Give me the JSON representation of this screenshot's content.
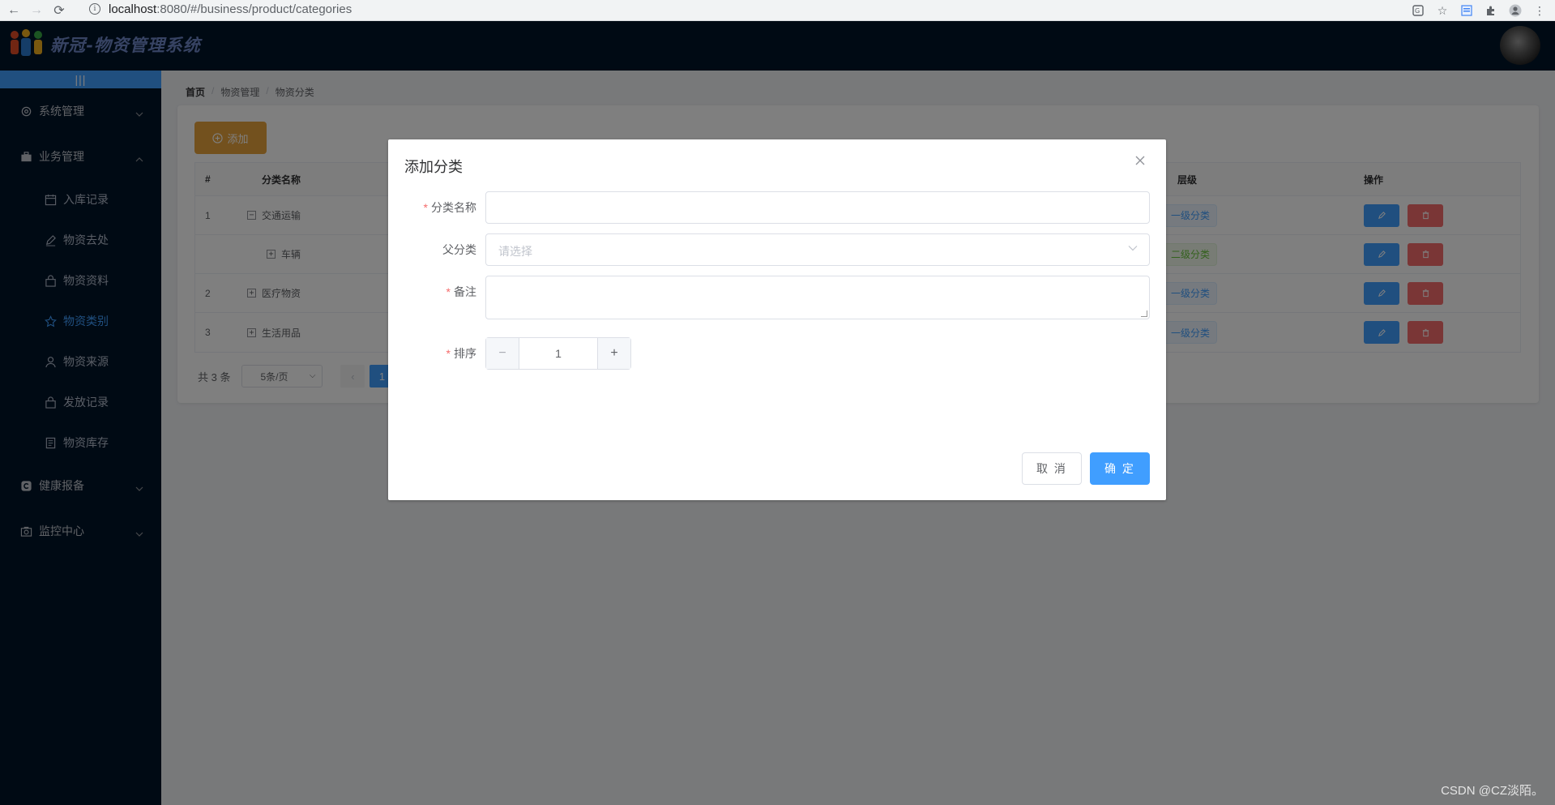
{
  "browser": {
    "url_host": "localhost",
    "url_path": ":8080/#/business/product/categories"
  },
  "header": {
    "app_title": "新冠-物资管理系统",
    "collapse_icon": "|||"
  },
  "sidebar": {
    "menus": [
      {
        "label": "系统管理",
        "icon": "gear-icon"
      },
      {
        "label": "业务管理",
        "icon": "briefcase-icon",
        "expanded": true,
        "items": [
          {
            "label": "入库记录",
            "icon": "calendar-icon"
          },
          {
            "label": "物资去处",
            "icon": "pen-icon"
          },
          {
            "label": "物资资料",
            "icon": "bag-icon"
          },
          {
            "label": "物资类别",
            "icon": "star-icon",
            "active": true
          },
          {
            "label": "物资来源",
            "icon": "user-icon"
          },
          {
            "label": "发放记录",
            "icon": "bag-icon"
          },
          {
            "label": "物资库存",
            "icon": "document-icon"
          }
        ]
      },
      {
        "label": "健康报备",
        "icon": "copyright-icon"
      },
      {
        "label": "监控中心",
        "icon": "camera-icon"
      }
    ]
  },
  "breadcrumb": [
    "首页",
    "物资管理",
    "物资分类"
  ],
  "toolbar": {
    "add_label": "添加"
  },
  "table": {
    "columns": {
      "index": "#",
      "name": "分类名称",
      "level": "层级",
      "actions": "操作"
    },
    "rows": [
      {
        "index": "1",
        "name": "交通运输",
        "expand": "−",
        "level": "一级分类",
        "level_type": "primary"
      },
      {
        "index": "",
        "name": "车辆",
        "expand": "+",
        "level": "二级分类",
        "level_type": "success"
      },
      {
        "index": "2",
        "name": "医疗物资",
        "expand": "+",
        "level": "一级分类",
        "level_type": "primary"
      },
      {
        "index": "3",
        "name": "生活用品",
        "expand": "+",
        "level": "一级分类",
        "level_type": "primary"
      }
    ]
  },
  "pagination": {
    "total": "共 3 条",
    "page_size": "5条/页",
    "current": "1"
  },
  "dialog": {
    "title": "添加分类",
    "fields": {
      "name_label": "分类名称",
      "parent_label": "父分类",
      "parent_placeholder": "请选择",
      "remark_label": "备注",
      "order_label": "排序",
      "order_value": "1"
    },
    "cancel_label": "取 消",
    "ok_label": "确 定"
  },
  "watermark": "CSDN @CZ淡陌。",
  "colors": {
    "primary": "#409eff",
    "warning": "#e6a23c",
    "danger": "#f56c6c",
    "success": "#67c23a",
    "sidebar": "#001529"
  }
}
